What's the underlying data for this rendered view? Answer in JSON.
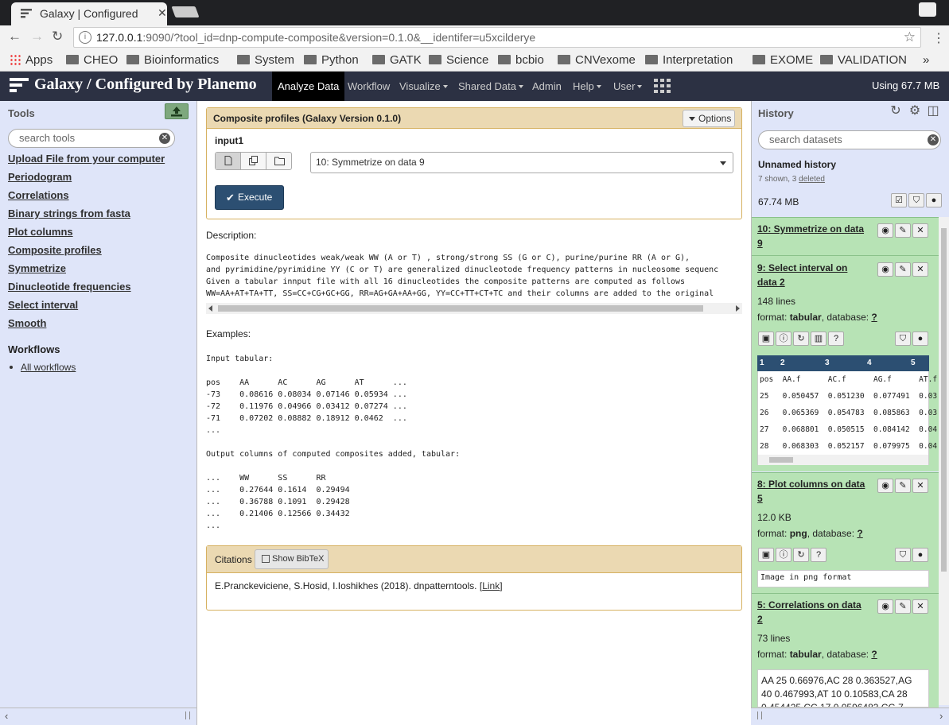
{
  "browser": {
    "tab_title": "Galaxy | Configured",
    "url_host": "127.0.0.1",
    "url_rest": ":9090/?tool_id=dnp-compute-composite&version=0.1.0&__identifer=u5xcilderye",
    "bookmarks": [
      "Apps",
      "CHEO",
      "Bioinformatics",
      "System",
      "Python",
      "GATK",
      "Science",
      "bcbio",
      "CNVexome",
      "Interpretation",
      "EXOME",
      "VALIDATION"
    ],
    "more": "»"
  },
  "masthead": {
    "brand": "Galaxy / Configured by Planemo",
    "items": [
      "Analyze Data",
      "Workflow",
      "Visualize",
      "Shared Data",
      "Admin",
      "Help",
      "User"
    ],
    "quota": "Using 67.7 MB"
  },
  "tools": {
    "title": "Tools",
    "search_placeholder": "search tools",
    "upload_link": "Upload File",
    "upload_suffix": " from your computer",
    "items": [
      "Periodogram",
      "Correlations",
      "Binary strings from fasta",
      "Plot columns",
      "Composite profiles",
      "Symmetrize",
      "Dinucleotide frequencies",
      "Select interval",
      "Smooth"
    ],
    "workflows_heading": "Workflows",
    "all_workflows": "All workflows"
  },
  "form": {
    "title": "Composite profiles (Galaxy Version 0.1.0)",
    "options_label": "Options",
    "input_label": "input1",
    "selected_dataset": "10: Symmetrize on data 9",
    "execute_label": "Execute"
  },
  "help": {
    "description_label": "Description:",
    "description_lines": [
      "Composite dinucleotides weak/weak WW (A or T) , strong/strong SS (G or C), purine/purine RR (A or G),",
      "and pyrimidine/pyrimidine YY (C or T) are generalized dinucleotode frequency patterns in nucleosome sequenc",
      "Given a tabular innput file with all 16 dinucleotides the composite patterns are computed as follows",
      "WW=AA+AT+TA+TT, SS=CC+CG+GC+GG, RR=AG+GA+AA+GG, YY=CC+TT+CT+TC and their columns are added to the original"
    ],
    "examples_label": "Examples:",
    "examples_lines": [
      "Input tabular:",
      "",
      "pos    AA      AC      AG      AT      ...",
      "-73    0.08616 0.08034 0.07146 0.05934 ...",
      "-72    0.11976 0.04966 0.03412 0.07274 ...",
      "-71    0.07202 0.08882 0.18912 0.0462  ...",
      "...",
      "",
      "Output columns of computed composites added, tabular:",
      "",
      "...    WW      SS      RR",
      "...    0.27644 0.1614  0.29494",
      "...    0.36788 0.1091  0.29428",
      "...    0.21406 0.12566 0.34432",
      "..."
    ]
  },
  "citations": {
    "title": "Citations",
    "bibtex_label": "Show BibTeX",
    "text": "E.Pranckeviciene, S.Hosid, I.Ioshikhes (2018). dnpatterntools. [",
    "link": "Link",
    "close": "]"
  },
  "history": {
    "title": "History",
    "search_placeholder": "search datasets",
    "name": "Unnamed history",
    "shown": "7 shown, 3 ",
    "deleted": "deleted",
    "size": "67.74 MB",
    "datasets": [
      {
        "title": "10: Symmetrize on data 9"
      },
      {
        "title": "9: Select interval on data 2",
        "lines": "148 lines",
        "format_label": "format: ",
        "format": "tabular",
        "db_label": ", database: ",
        "db": "?",
        "peek_header": [
          "1",
          "2",
          "3",
          "4",
          "5"
        ],
        "peek_rows": [
          "pos  AA.f      AC.f      AG.f      AT.f",
          "25   0.050457  0.051230  0.077491  0.03",
          "26   0.065369  0.054783  0.085863  0.03",
          "27   0.068801  0.050515  0.084142  0.04",
          "28   0.068303  0.052157  0.079975  0.04"
        ]
      },
      {
        "title": "8: Plot columns on data 5",
        "size": "12.0 KB",
        "format_label": "format: ",
        "format": "png",
        "db_label": ", database: ",
        "db": "?",
        "peek": "Image in png format"
      },
      {
        "title": "5: Correlations on data 2",
        "lines": "73 lines",
        "format_label": "format: ",
        "format": "tabular",
        "db_label": ", database: ",
        "db": "?",
        "peek": "AA 25 0.66976,AC 28 0.363527,AG 40 0.467993,AT 10 0.10583,CA 28 0.454425,CC 17 0.0596483,CG 7"
      }
    ]
  },
  "colors": {
    "masthead": "#2c3143",
    "panel": "#dfe5f9",
    "dataset_ok": "#b7e3b5",
    "form_header": "#ebd9b2",
    "execute": "#2c4f72"
  }
}
